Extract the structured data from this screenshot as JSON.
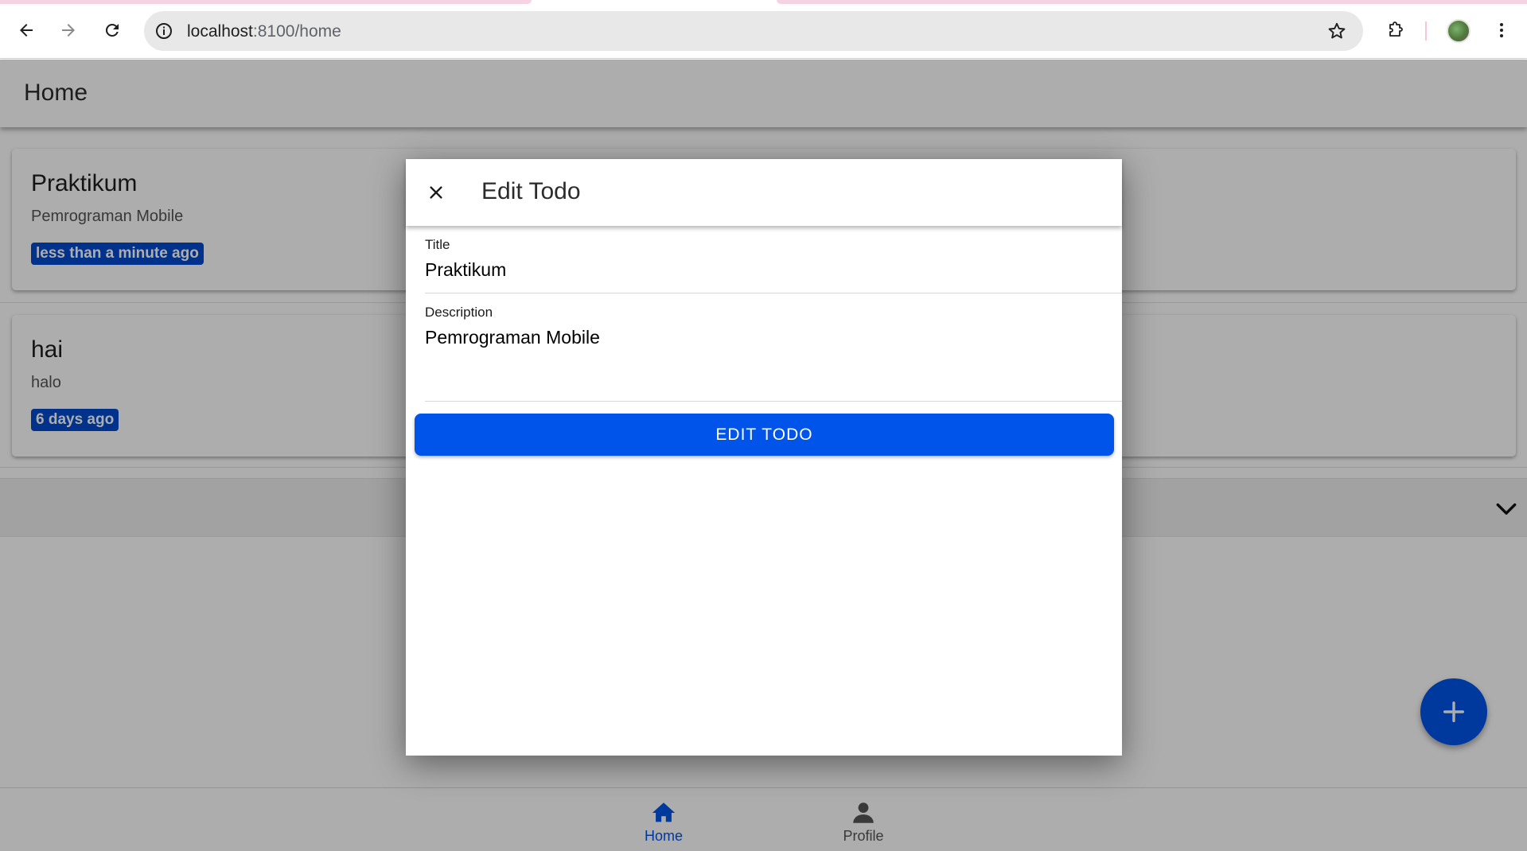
{
  "browser": {
    "url_host": "localhost",
    "url_rest": ":8100/home",
    "icons": {
      "back": "arrow-left-icon",
      "forward": "arrow-right-icon",
      "reload": "reload-icon",
      "info": "info-icon",
      "bookmark": "star-icon",
      "extensions": "puzzle-icon",
      "menu": "kebab-menu-icon"
    }
  },
  "header": {
    "title": "Home"
  },
  "todos": [
    {
      "title": "Praktikum",
      "description": "Pemrograman Mobile",
      "time": "less than a minute ago"
    },
    {
      "title": "hai",
      "description": "halo",
      "time": "6 days ago"
    }
  ],
  "modal": {
    "title": "Edit Todo",
    "title_label": "Title",
    "title_value": "Praktikum",
    "description_label": "Description",
    "description_value": "Pemrograman Mobile",
    "submit_label": "EDIT TODO"
  },
  "tabs": [
    {
      "label": "Home",
      "icon": "home-icon",
      "active": true
    },
    {
      "label": "Profile",
      "icon": "person-icon",
      "active": false
    }
  ],
  "colors": {
    "primary": "#0054e9",
    "badge": "#004acd",
    "tabstrip": "#f6d3e1"
  }
}
